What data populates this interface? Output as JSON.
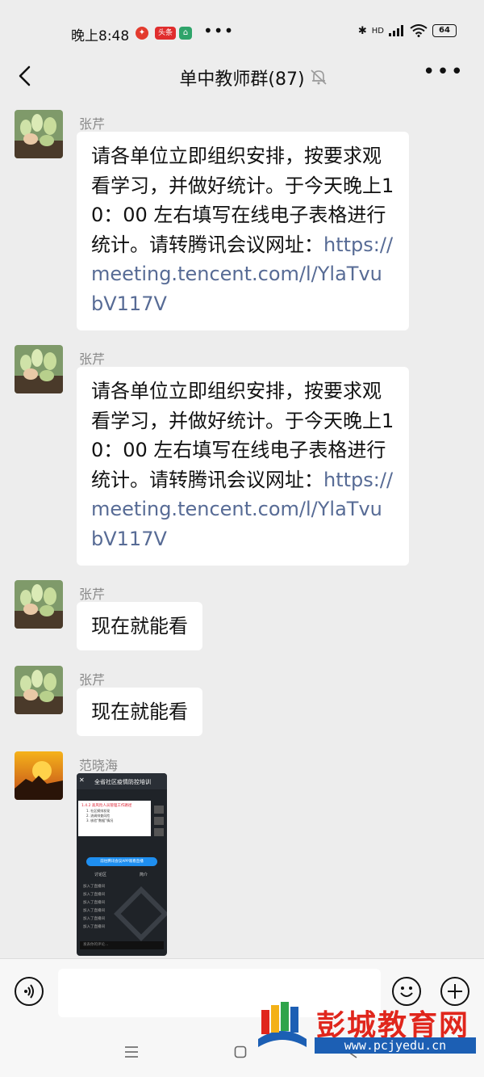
{
  "status_bar": {
    "time": "晚上8:48",
    "badge_1_text": "头条",
    "network": "HD",
    "battery": "64"
  },
  "header": {
    "title": "单中教师群(87)"
  },
  "messages": [
    {
      "sender": "张芹",
      "text_plain": "请各单位立即组织安排，按要求观看学习，并做好统计。于今天晚上10：00 左右填写在线电子表格进行统计。请转腾讯会议网址：",
      "link": "https://meeting.tencent.com/l/YlaTvubV117V"
    },
    {
      "sender": "张芹",
      "text_plain": "请各单位立即组织安排，按要求观看学习，并做好统计。于今天晚上10：00 左右填写在线电子表格进行统计。请转腾讯会议网址：",
      "link": "https://meeting.tencent.com/l/YlaTvubV117V"
    },
    {
      "sender": "张芹",
      "text_plain": "现在就能看"
    },
    {
      "sender": "张芹",
      "text_plain": "现在就能看"
    },
    {
      "sender": "范晓海",
      "image": {
        "title": "全省社区疫情防控培训",
        "slide_heading": "1.4.2 高风险人员管理工作路径",
        "slide_lines": [
          "1. 社区摸排发现",
          "2. 流调排查风险",
          "3. 核验“数据”情况"
        ],
        "button": "前往腾讯会议APP观看直播",
        "tab_1": "讨论区",
        "tab_2": "简介",
        "chat_lines": [
          "加入了直播间",
          "加入了直播间",
          "加入了直播间",
          "加入了直播间",
          "加入了直播间",
          "加入了直播间"
        ],
        "input_hint": "发表你的评论…"
      }
    }
  ],
  "watermark": {
    "name": "彭城教育网",
    "url": "www.pcjyedu.cn"
  }
}
